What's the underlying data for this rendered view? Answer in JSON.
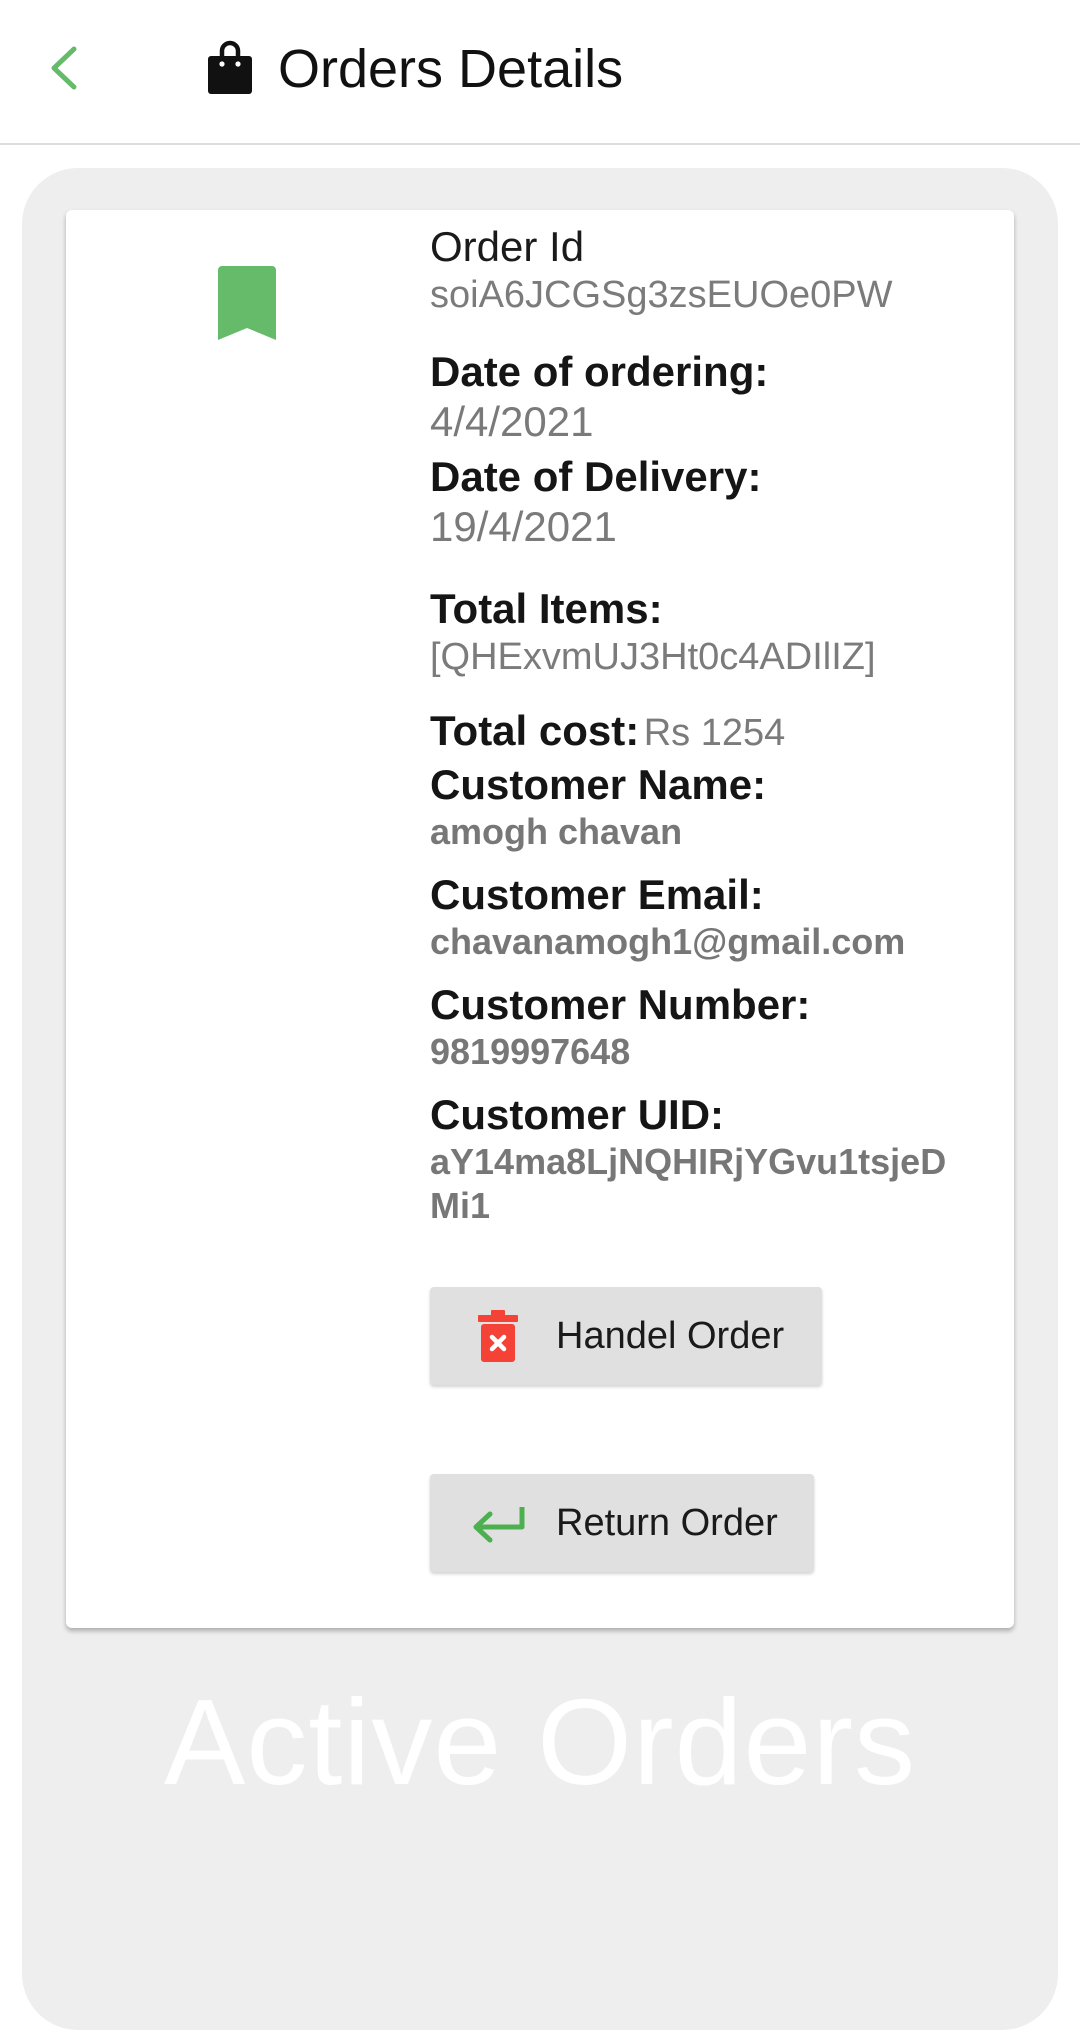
{
  "header": {
    "title": "Orders Details",
    "back_icon": "chevron-left-icon",
    "title_icon": "shopping-bag-icon"
  },
  "colors": {
    "accent_green": "#66bb6a",
    "delete_red": "#f44336",
    "panel_gray": "#eeeeee"
  },
  "order": {
    "bookmark_icon": "bookmark-icon",
    "id_label": "Order Id",
    "id_value": "soiA6JCGSg3zsEUOe0PW",
    "date_ordering_label": "Date of ordering:",
    "date_ordering_value": "4/4/2021",
    "date_delivery_label": "Date of Delivery:",
    "date_delivery_value": "19/4/2021",
    "total_items_label": "Total Items:",
    "total_items_value": "[QHExvmUJ3Ht0c4ADIlIZ]",
    "total_cost_label": "Total cost:",
    "total_cost_value": "Rs 1254",
    "customer_name_label": "Customer Name:",
    "customer_name_value": "amogh chavan",
    "customer_email_label": "Customer Email:",
    "customer_email_value": "chavanamogh1@gmail.com",
    "customer_number_label": "Customer Number:",
    "customer_number_value": "9819997648",
    "customer_uid_label": "Customer UID:",
    "customer_uid_value": "aY14ma8LjNQHIRjYGvu1tsjeDMi1"
  },
  "actions": {
    "handle_label": "Handel Order",
    "handle_icon": "trash-delete-icon",
    "return_label": "Return Order",
    "return_icon": "return-arrow-icon"
  },
  "watermark": {
    "text": "Active Orders"
  }
}
